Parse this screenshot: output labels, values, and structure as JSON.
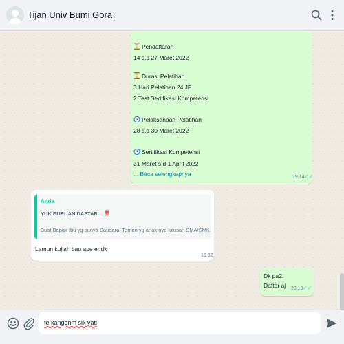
{
  "header": {
    "contact_name": "Tijan Univ Bumi Gora",
    "icons": [
      "search-icon",
      "menu-icon"
    ]
  },
  "messages": {
    "m1": {
      "lines": [
        "Pendaftaran",
        "14 s.d 27 Maret 2022",
        "Durasi Pelatihan",
        "3 Hari Pelatihan 24 JP",
        "2 Test Sertifikasi Kompetensi",
        "Pelaksanaan Pelatihan",
        "28 s.d 30 Maret 2022",
        "Sertifikasi Kompetensi",
        "31 Maret s.d 1 April 2022"
      ],
      "read_more": "... Baca selengkapnya",
      "time": "19.14",
      "icons": [
        "hourglass-icon",
        "hourglass-half-icon",
        "alarm-clock-icon",
        "alarm-clock-icon"
      ]
    },
    "m2": {
      "quote_sender": "Anda",
      "quote_title": "YUK BURUAN DAFTAR ...",
      "quote_emoji": "‼",
      "quote_text": "Buat Bapak Ibu yg punya Saudara, Temen yg anak nya lulusan SMA/SMK yg ...",
      "text": "Lemun kuliah bau ape endk",
      "time": "19.32"
    },
    "m3": {
      "lines": [
        "Dk pa2.",
        "Daftar aj"
      ],
      "time": "23.19"
    }
  },
  "composer": {
    "input_value": "te kangenm sik yati",
    "icons": [
      "emoji-icon",
      "attach-icon",
      "send-icon"
    ]
  },
  "colors": {
    "outgoing_bubble": "#d9fdd3",
    "incoming_bubble": "#ffffff",
    "quote_accent": "#06cf9c",
    "read_ticks": "#53bdeb",
    "link": "#027eb5"
  }
}
